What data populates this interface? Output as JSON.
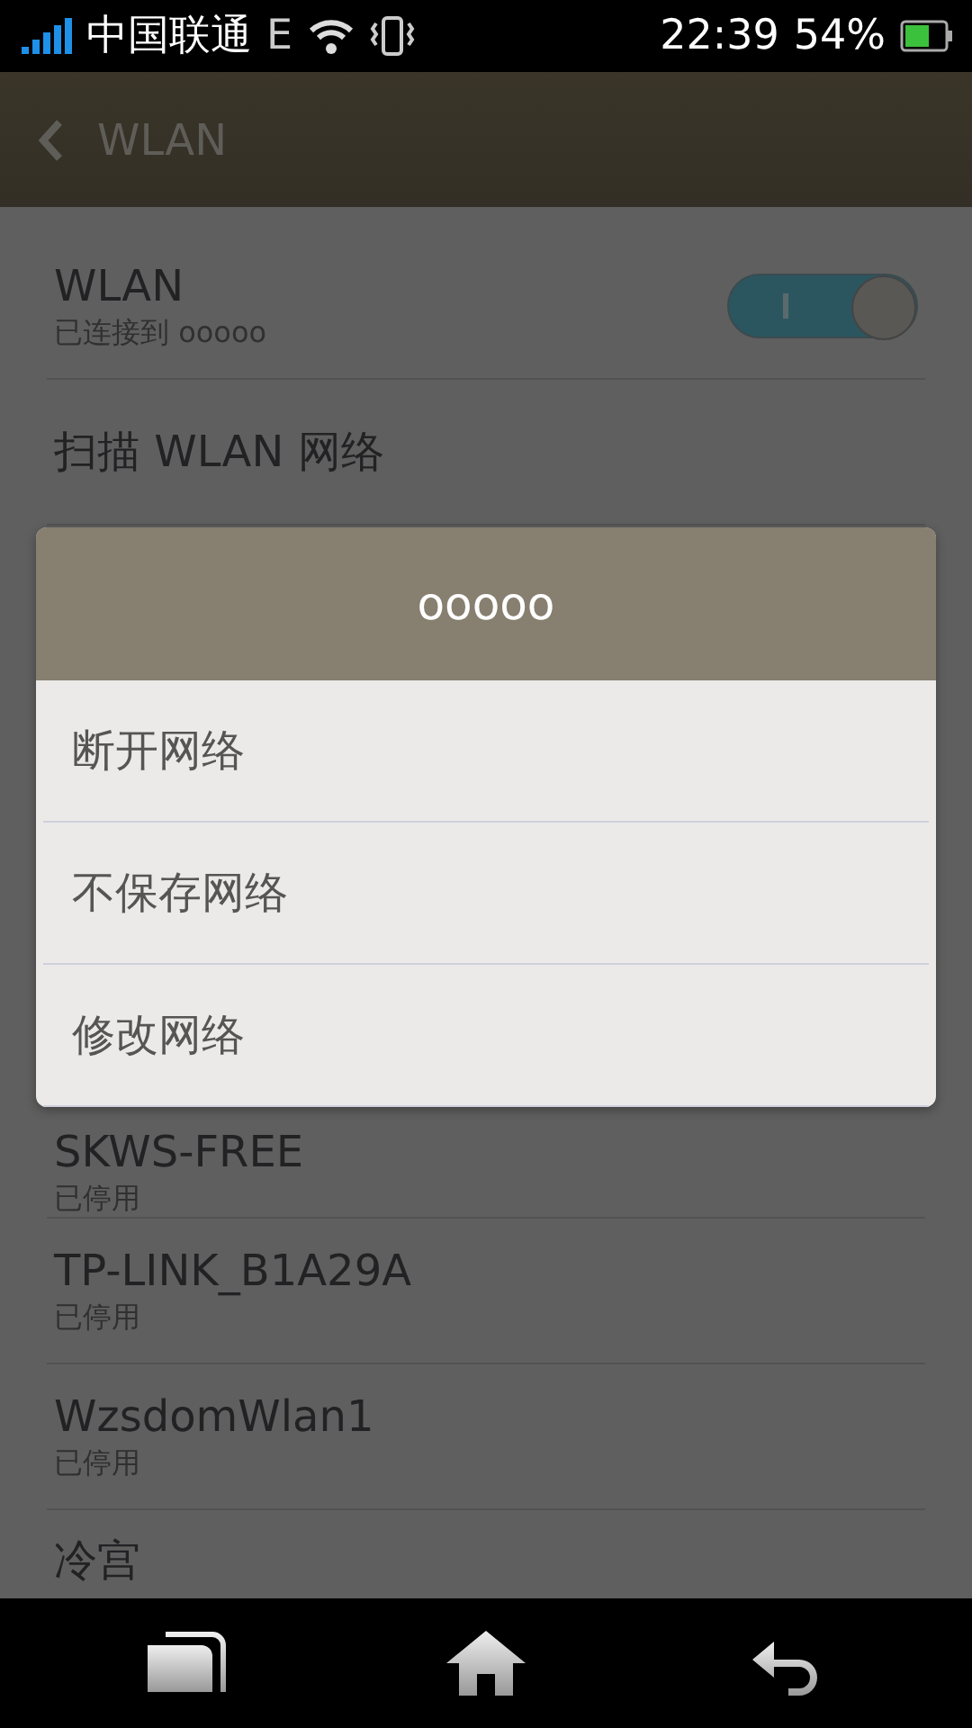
{
  "status_bar": {
    "carrier": "中国联通",
    "network": "E",
    "time": "22:39",
    "battery": "54%"
  },
  "header": {
    "title": "WLAN"
  },
  "settings": [
    {
      "kind": "toggle",
      "title": "WLAN",
      "subtitle": "已连接到 ooooo",
      "on": true
    },
    {
      "kind": "action",
      "title": "扫描 WLAN 网络"
    }
  ],
  "networks": [
    {
      "name": "SKWS-FREE",
      "status": "已停用"
    },
    {
      "name": "TP-LINK_B1A29A",
      "status": "已停用"
    },
    {
      "name": "WzsdomWlan1",
      "status": "已停用"
    },
    {
      "name": "冷宫"
    }
  ],
  "dialog": {
    "title": "ooooo",
    "options": [
      "断开网络",
      "不保存网络",
      "修改网络"
    ]
  }
}
